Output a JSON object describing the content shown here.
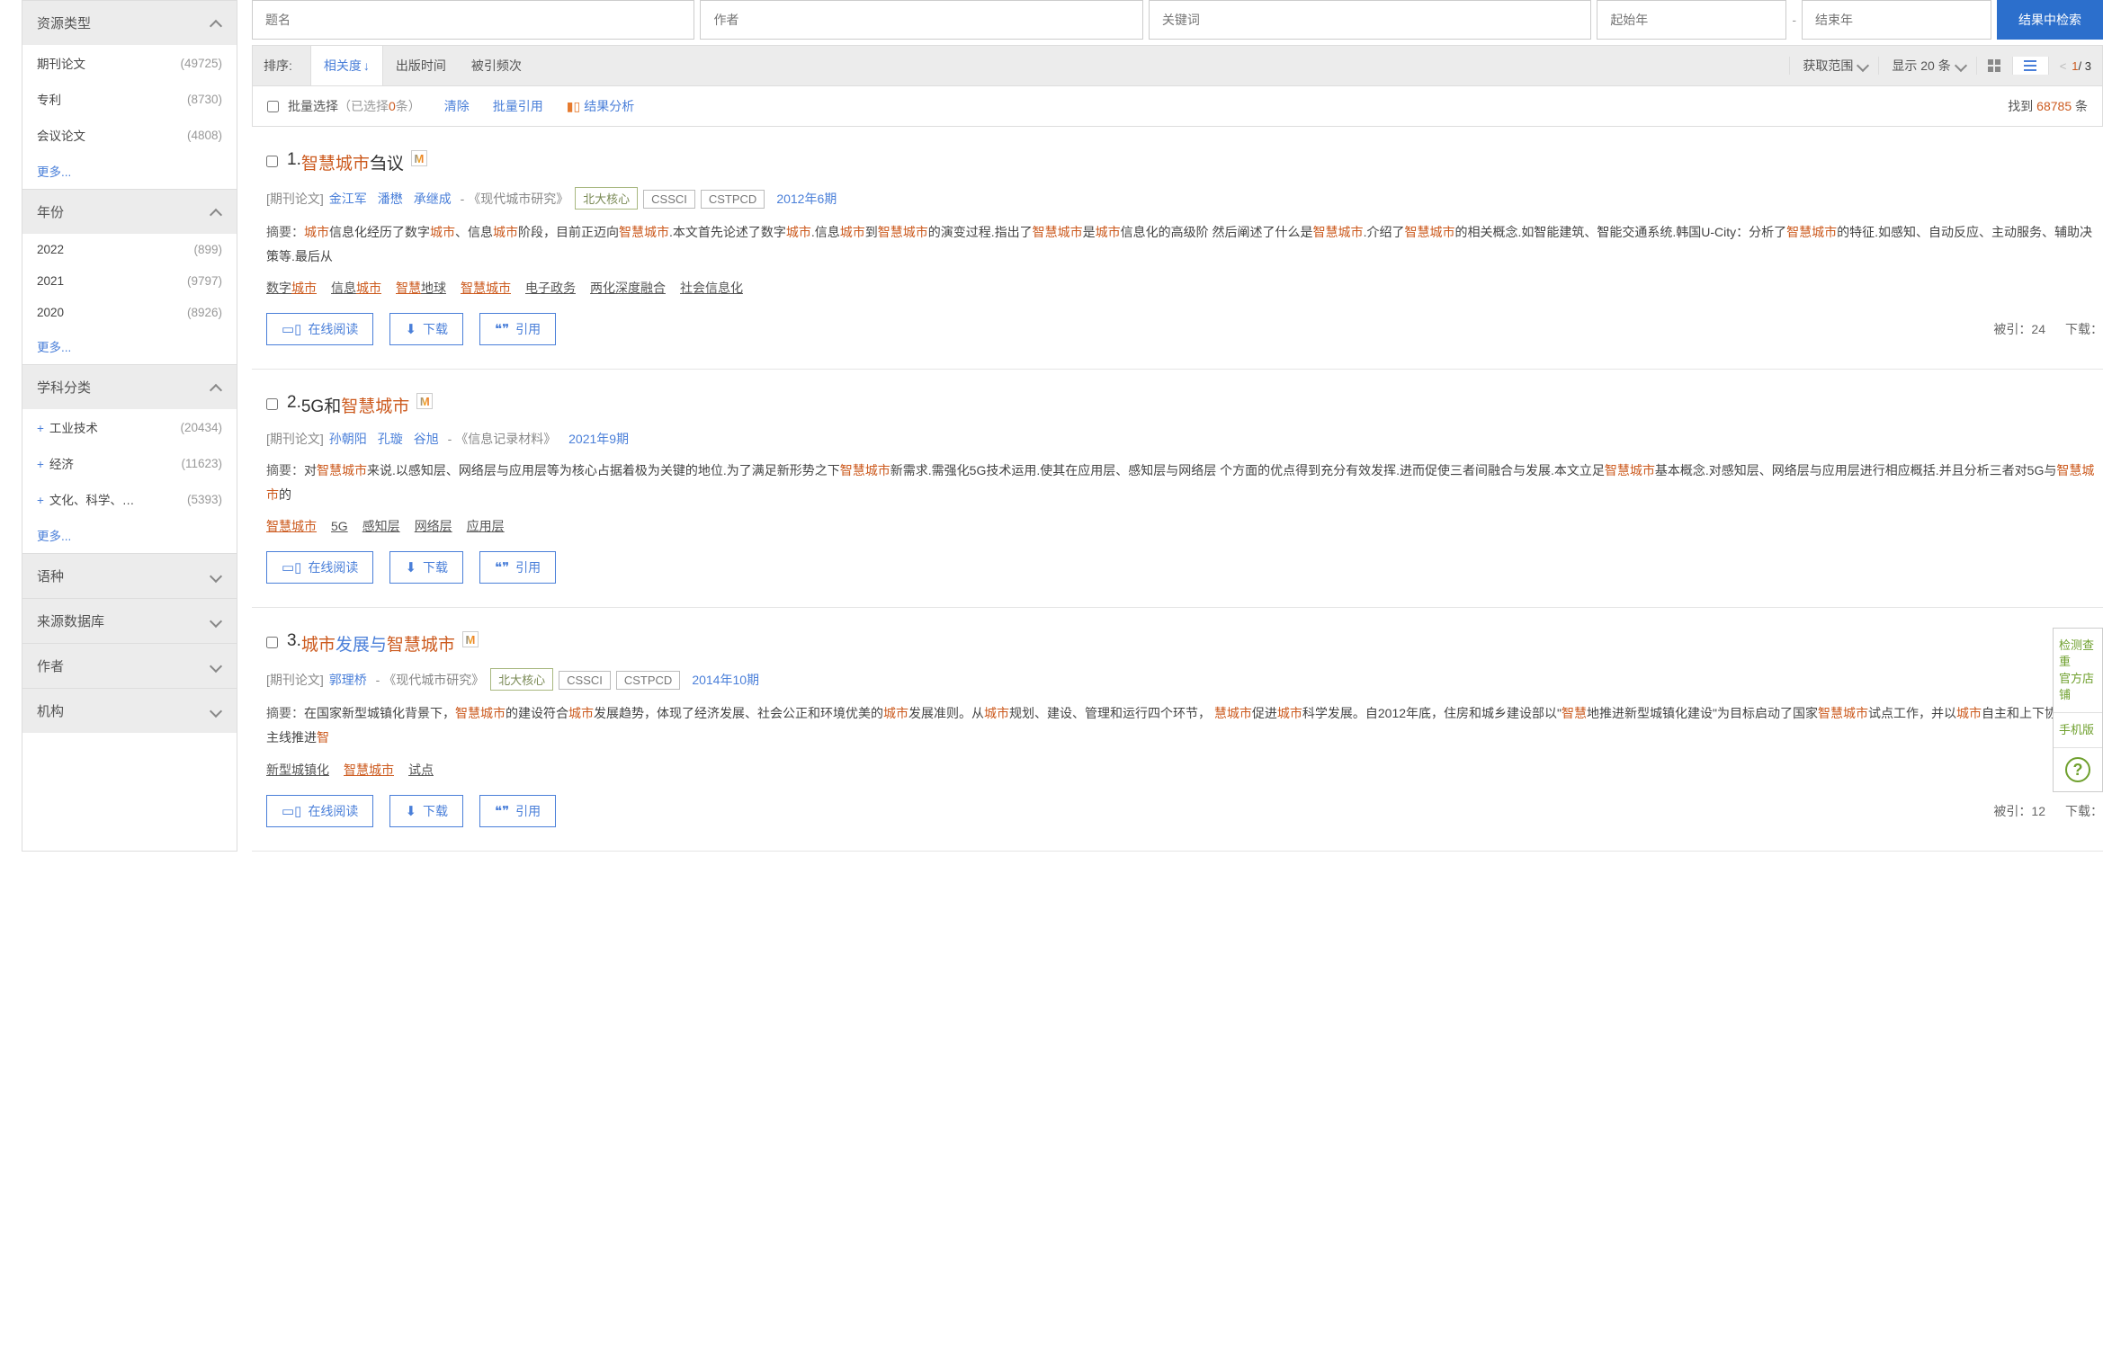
{
  "search": {
    "title_ph": "题名",
    "author_ph": "作者",
    "keyword_ph": "关键词",
    "year_from_ph": "起始年",
    "year_to_ph": "结束年",
    "button": "结果中检索"
  },
  "facets": [
    {
      "title": "资源类型",
      "expanded": true,
      "items": [
        {
          "label": "期刊论文",
          "count": "(49725)"
        },
        {
          "label": "专利",
          "count": "(8730)"
        },
        {
          "label": "会议论文",
          "count": "(4808)"
        }
      ],
      "more": "更多..."
    },
    {
      "title": "年份",
      "expanded": true,
      "items": [
        {
          "label": "2022",
          "count": "(899)"
        },
        {
          "label": "2021",
          "count": "(9797)"
        },
        {
          "label": "2020",
          "count": "(8926)"
        }
      ],
      "more": "更多..."
    },
    {
      "title": "学科分类",
      "expanded": true,
      "items": [
        {
          "label": "工业技术",
          "count": "(20434)",
          "plus": true
        },
        {
          "label": "经济",
          "count": "(11623)",
          "plus": true
        },
        {
          "label": "文化、科学、…",
          "count": "(5393)",
          "plus": true
        }
      ],
      "more": "更多..."
    },
    {
      "title": "语种",
      "expanded": false
    },
    {
      "title": "来源数据库",
      "expanded": false
    },
    {
      "title": "作者",
      "expanded": false
    },
    {
      "title": "机构",
      "expanded": false
    }
  ],
  "toolbar": {
    "sort_label": "排序:",
    "sorts": [
      {
        "label": "相关度",
        "active": true
      },
      {
        "label": "出版时间"
      },
      {
        "label": "被引频次"
      }
    ],
    "scope_label": "获取范围",
    "pagesize_label": "显示 20 条",
    "pager_prev": "<",
    "pager_cur": "1",
    "pager_sep": " / 3"
  },
  "batch": {
    "label": "批量选择",
    "selected_pre": "（已选择",
    "selected_cnt": "0",
    "selected_post": "条）",
    "clear": "清除",
    "cite": "批量引用",
    "analyze": "结果分析",
    "found_pre": "找到",
    "found_total": "68785",
    "found_post": "条"
  },
  "results": [
    {
      "num": "1.",
      "title_parts": [
        {
          "t": "智慧城市",
          "hl": true
        },
        {
          "t": "刍议"
        }
      ],
      "type": "[期刊论文]",
      "authors": [
        "金江军",
        "潘懋",
        "承继成"
      ],
      "source": " - 《现代城市研究》",
      "badges": [
        "北大核心",
        "CSSCI",
        "CSTPCD"
      ],
      "issue": "2012年6期",
      "abs_label": "摘要：",
      "abs_parts": [
        {
          "t": "城市",
          "hl": true
        },
        {
          "t": "信息化经历了数字"
        },
        {
          "t": "城市",
          "hl": true
        },
        {
          "t": "、信息"
        },
        {
          "t": "城市",
          "hl": true
        },
        {
          "t": "阶段，目前正迈向"
        },
        {
          "t": "智慧城市",
          "hl": true
        },
        {
          "t": ".本文首先论述了数字"
        },
        {
          "t": "城市",
          "hl": true
        },
        {
          "t": ".信息"
        },
        {
          "t": "城市",
          "hl": true
        },
        {
          "t": "到"
        },
        {
          "t": "智慧城市",
          "hl": true
        },
        {
          "t": "的演变过程.指出了"
        },
        {
          "t": "智慧城市",
          "hl": true
        },
        {
          "t": "是"
        },
        {
          "t": "城市",
          "hl": true
        },
        {
          "t": "信息化的高级阶 然后阐述了什么是"
        },
        {
          "t": "智慧城市",
          "hl": true
        },
        {
          "t": ".介绍了"
        },
        {
          "t": "智慧城市",
          "hl": true
        },
        {
          "t": "的相关概念.如智能建筑、智能交通系统.韩国U-City：分析了"
        },
        {
          "t": "智慧城市",
          "hl": true
        },
        {
          "t": "的特征.如感知、自动反应、主动服务、辅助决策等.最后从"
        }
      ],
      "keywords": [
        [
          {
            "t": "数字"
          },
          {
            "t": "城市",
            "hl": true
          }
        ],
        [
          {
            "t": "信息"
          },
          {
            "t": "城市",
            "hl": true
          }
        ],
        [
          {
            "t": "智慧",
            "hl": true
          },
          {
            "t": "地球"
          }
        ],
        [
          {
            "t": "智慧城市",
            "hl": true
          }
        ],
        [
          {
            "t": "电子政务"
          }
        ],
        [
          {
            "t": "两化深度融合"
          }
        ],
        [
          {
            "t": "社会信息化"
          }
        ]
      ],
      "cited_label": "被引：",
      "cited": "24",
      "dl_label": "下载："
    },
    {
      "num": "2.",
      "title_parts": [
        {
          "t": "5G和"
        },
        {
          "t": "智慧城市",
          "hl": true
        }
      ],
      "type": "[期刊论文]",
      "authors": [
        "孙朝阳",
        "孔璇",
        "谷旭"
      ],
      "source": "  - 《信息记录材料》",
      "badges": [],
      "issue": "2021年9期",
      "abs_label": "摘要：",
      "abs_parts": [
        {
          "t": "对"
        },
        {
          "t": "智慧城市",
          "hl": true
        },
        {
          "t": "来说.以感知层、网络层与应用层等为核心占据着极为关键的地位.为了满足新形势之下"
        },
        {
          "t": "智慧城市",
          "hl": true
        },
        {
          "t": "新需求.需强化5G技术运用.使其在应用层、感知层与网络层 个方面的优点得到充分有效发挥.进而促使三者间融合与发展.本文立足"
        },
        {
          "t": "智慧城市",
          "hl": true
        },
        {
          "t": "基本概念.对感知层、网络层与应用层进行相应概括.并且分析三者对5G与"
        },
        {
          "t": "智慧城市",
          "hl": true
        },
        {
          "t": "的"
        }
      ],
      "keywords": [
        [
          {
            "t": "智慧城市",
            "hl": true
          }
        ],
        [
          {
            "t": "5G"
          }
        ],
        [
          {
            "t": "感知层"
          }
        ],
        [
          {
            "t": "网络层"
          }
        ],
        [
          {
            "t": "应用层"
          }
        ]
      ]
    },
    {
      "num": "3.",
      "title_parts": [
        {
          "t": "城市",
          "hl": true
        },
        {
          "t": "发展与",
          "link": true
        },
        {
          "t": "智慧城市",
          "hl": true
        }
      ],
      "type": "[期刊论文]",
      "authors": [
        "郭理桥"
      ],
      "source": " - 《现代城市研究》",
      "badges": [
        "北大核心",
        "CSSCI",
        "CSTPCD"
      ],
      "issue": "2014年10期",
      "abs_label": "摘要：",
      "abs_parts": [
        {
          "t": "在国家新型城镇化背景下，"
        },
        {
          "t": "智慧城市",
          "hl": true
        },
        {
          "t": "的建设符合"
        },
        {
          "t": "城市",
          "hl": true
        },
        {
          "t": "发展趋势，体现了经济发展、社会公正和环境优美的"
        },
        {
          "t": "城市",
          "hl": true
        },
        {
          "t": "发展准则。从"
        },
        {
          "t": "城市",
          "hl": true
        },
        {
          "t": "规划、建设、管理和运行四个环节， "
        },
        {
          "t": "慧城市",
          "hl": true
        },
        {
          "t": "促进"
        },
        {
          "t": "城市",
          "hl": true
        },
        {
          "t": "科学发展。自2012年底，住房和城乡建设部以\""
        },
        {
          "t": "智慧",
          "hl": true
        },
        {
          "t": "地推进新型城镇化建设\"为目标启动了国家"
        },
        {
          "t": "智慧城市",
          "hl": true
        },
        {
          "t": "试点工作，并以"
        },
        {
          "t": "城市",
          "hl": true
        },
        {
          "t": "自主和上下协同两条主线推进"
        },
        {
          "t": "智",
          "hl": true
        }
      ],
      "keywords": [
        [
          {
            "t": "新型城镇化"
          }
        ],
        [
          {
            "t": "智慧城市",
            "hl": true
          }
        ],
        [
          {
            "t": "试点"
          }
        ]
      ],
      "cited_label": "被引：",
      "cited": "12",
      "dl_label": "下载："
    }
  ],
  "actions": {
    "read": "在线阅读",
    "download": "下载",
    "cite": "引用"
  },
  "float": {
    "check": "检测查重",
    "shop": "官方店铺",
    "mobile": "手机版"
  }
}
